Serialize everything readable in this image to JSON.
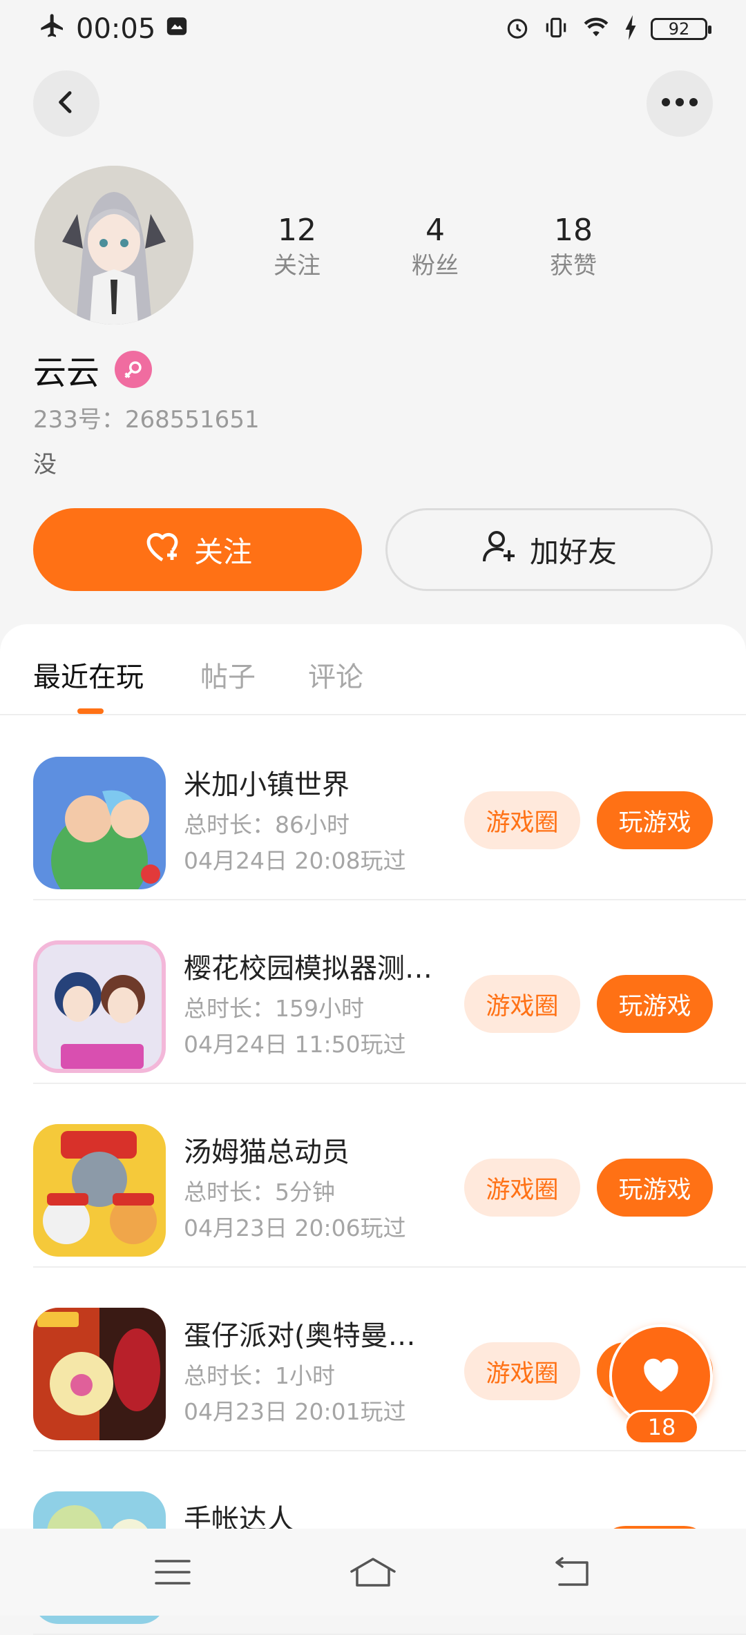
{
  "status_bar": {
    "time": "00:05",
    "battery": "92"
  },
  "profile": {
    "name": "云云",
    "uid": "233号：268551651",
    "bio": "没",
    "stats": [
      {
        "value": "12",
        "label": "关注"
      },
      {
        "value": "4",
        "label": "粉丝"
      },
      {
        "value": "18",
        "label": "获赞"
      }
    ],
    "follow_label": "关注",
    "add_friend_label": "加好友"
  },
  "tabs": [
    {
      "label": "最近在玩",
      "active": true
    },
    {
      "label": "帖子",
      "active": false
    },
    {
      "label": "评论",
      "active": false
    }
  ],
  "games": [
    {
      "name": "米加小镇世界",
      "duration": "总时长：86小时",
      "last_played": "04月24日 20:08玩过",
      "circle_label": "游戏圈",
      "play_label": "玩游戏"
    },
    {
      "name": "樱花校园模拟器测…",
      "duration": "总时长：159小时",
      "last_played": "04月24日 11:50玩过",
      "circle_label": "游戏圈",
      "play_label": "玩游戏"
    },
    {
      "name": "汤姆猫总动员",
      "duration": "总时长：5分钟",
      "last_played": "04月23日 20:06玩过",
      "circle_label": "游戏圈",
      "play_label": "玩游戏"
    },
    {
      "name": "蛋仔派对(奥特曼…",
      "duration": "总时长：1小时",
      "last_played": "04月23日 20:01玩过",
      "circle_label": "游戏圈",
      "play_label": "玩游戏"
    },
    {
      "name": "手帐达人",
      "duration": "",
      "last_played": "",
      "circle_label": "",
      "play_label": ""
    }
  ],
  "like_fab": {
    "count": "18"
  },
  "colors": {
    "accent": "#ff7115",
    "accent_light": "#ffe9dc",
    "female": "#f06ca0"
  }
}
